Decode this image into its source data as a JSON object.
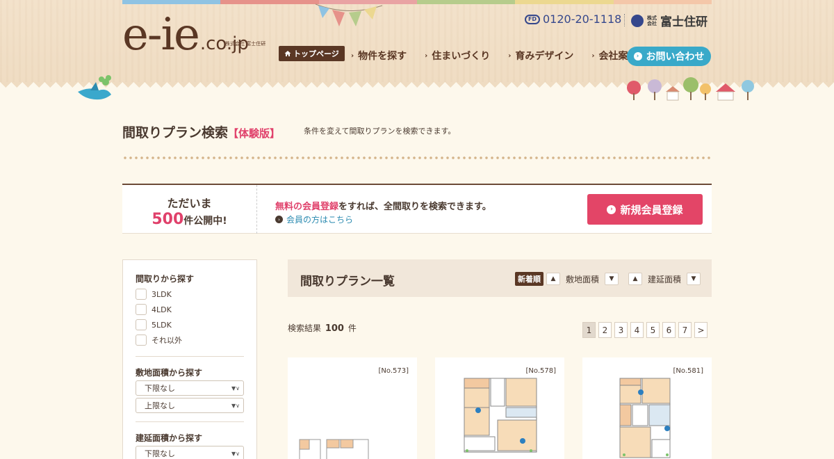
{
  "colors": {
    "brand_brown": "#5a3724",
    "accent_pink": "#e34567",
    "accent_blue": "#39a9c9",
    "phone_blue": "#35478c",
    "topbar": [
      "#8fc3e3",
      "#e6928a",
      "#e9a3a3",
      "#b6cc8c",
      "#ecd890",
      "#f4c7a9"
    ]
  },
  "header": {
    "logo_main": "e-ie",
    "logo_tld": ".co.jp",
    "logo_sub": "株式会社 富士住研",
    "top_page_label": "トップページ",
    "nav": [
      "物件を探す",
      "住まいづくり",
      "育みデザイン",
      "会社案内"
    ],
    "contact_label": "お問い合わせ",
    "phone_badge": "FD",
    "phone_number": "0120-20-1118",
    "company_small": "株式会社",
    "company_name": "富士住研"
  },
  "page": {
    "title": "間取りプラン検索",
    "title_badge": "【体験版】",
    "description": "条件を変えて間取りプランを検索できます。"
  },
  "banner": {
    "line1": "ただいま",
    "count": "500",
    "line2_suffix": "件公開中!",
    "message_highlight": "無料の会員登録",
    "message_rest": "をすれば、全間取りを検索できます。",
    "member_link": "会員の方はこちら",
    "register_label": "新規会員登録"
  },
  "sidebar": {
    "layout_heading": "間取りから探す",
    "layout_options": [
      "3LDK",
      "4LDK",
      "5LDK",
      "それ以外"
    ],
    "land_heading": "敷地面積から探す",
    "land_min": "下限なし",
    "land_max": "上限なし",
    "floor_heading": "建延面積から探す",
    "floor_min": "下限なし"
  },
  "list": {
    "title": "間取りプラン一覧",
    "sort_newest": "新着順",
    "sort_land": "敷地面積",
    "sort_floor": "建延面積",
    "result_prefix": "検索結果",
    "result_count": "100",
    "result_suffix": "件",
    "pages": [
      "1",
      "2",
      "3",
      "4",
      "5",
      "6",
      "7",
      ">"
    ],
    "current_page": "1"
  },
  "cards": [
    {
      "no": "[No.573]"
    },
    {
      "no": "[No.578]"
    },
    {
      "no": "[No.581]"
    }
  ]
}
